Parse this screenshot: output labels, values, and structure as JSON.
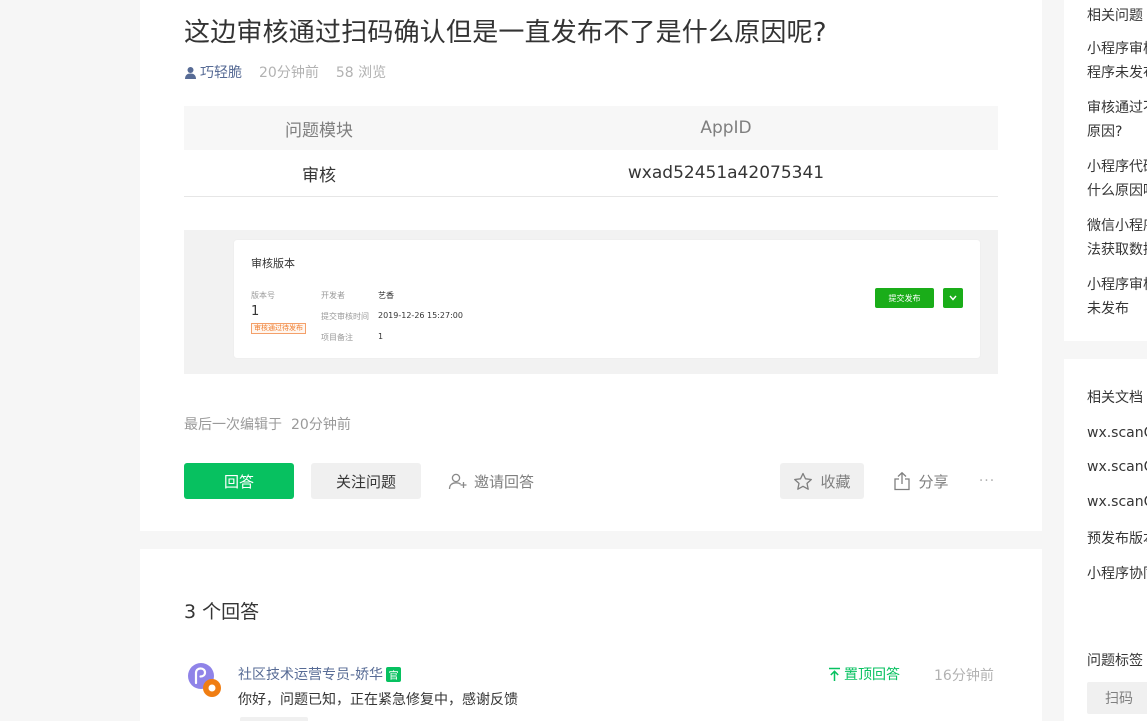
{
  "question": {
    "title": "这边审核通过扫码确认但是一直发布不了是什么原因呢?",
    "author": "巧轻脆",
    "time": "20分钟前",
    "views": "58 浏览",
    "table": {
      "headers": [
        "问题模块",
        "AppID"
      ],
      "row": [
        "审核",
        "wxad52451a42075341"
      ]
    },
    "screenshot": {
      "title": "审核版本",
      "version_label": "版本号",
      "version": "1",
      "status_badge": "审核通过待发布",
      "developer_label": "开发者",
      "developer": "艺香",
      "submit_time_label": "提交审核时间",
      "submit_time": "2019-12-26 15:27:00",
      "note_label": "项目备注",
      "note": "1",
      "submit_button": "提交发布"
    },
    "edited_label": "最后一次编辑于",
    "edited_time": "20分钟前",
    "actions": {
      "answer": "回答",
      "follow": "关注问题",
      "invite": "邀请回答",
      "favorite": "收藏",
      "share": "分享",
      "more": "···"
    }
  },
  "answers": {
    "count": "3 个回答",
    "items": [
      {
        "author": "社区技术运营专员-娇华",
        "badge": "官",
        "text": "你好，问题已知，正在紧急修复中，感谢反馈",
        "pin_label": "置顶回答",
        "time": "16分钟前"
      }
    ]
  },
  "sidebar": {
    "related_questions_title": "相关问题",
    "related_questions": [
      "小程序审核通过，但小程序未发布",
      "审核通过不能发布什么原因?",
      "小程序代码审核未通过什么原因呢?",
      "微信小程序审核通过无法获取数据",
      "小程序审核通过，但是未发布"
    ],
    "related_docs_title": "相关文档",
    "related_docs": [
      "wx.scanCode",
      "wx.scanCode",
      "wx.scanCode",
      "预发布版本",
      "小程序协同"
    ],
    "tags_title": "问题标签",
    "tags": [
      "扫码"
    ]
  },
  "colors": {
    "primary_green": "#07c160",
    "link_blue": "#576b95",
    "muted": "#b2b2b2"
  }
}
